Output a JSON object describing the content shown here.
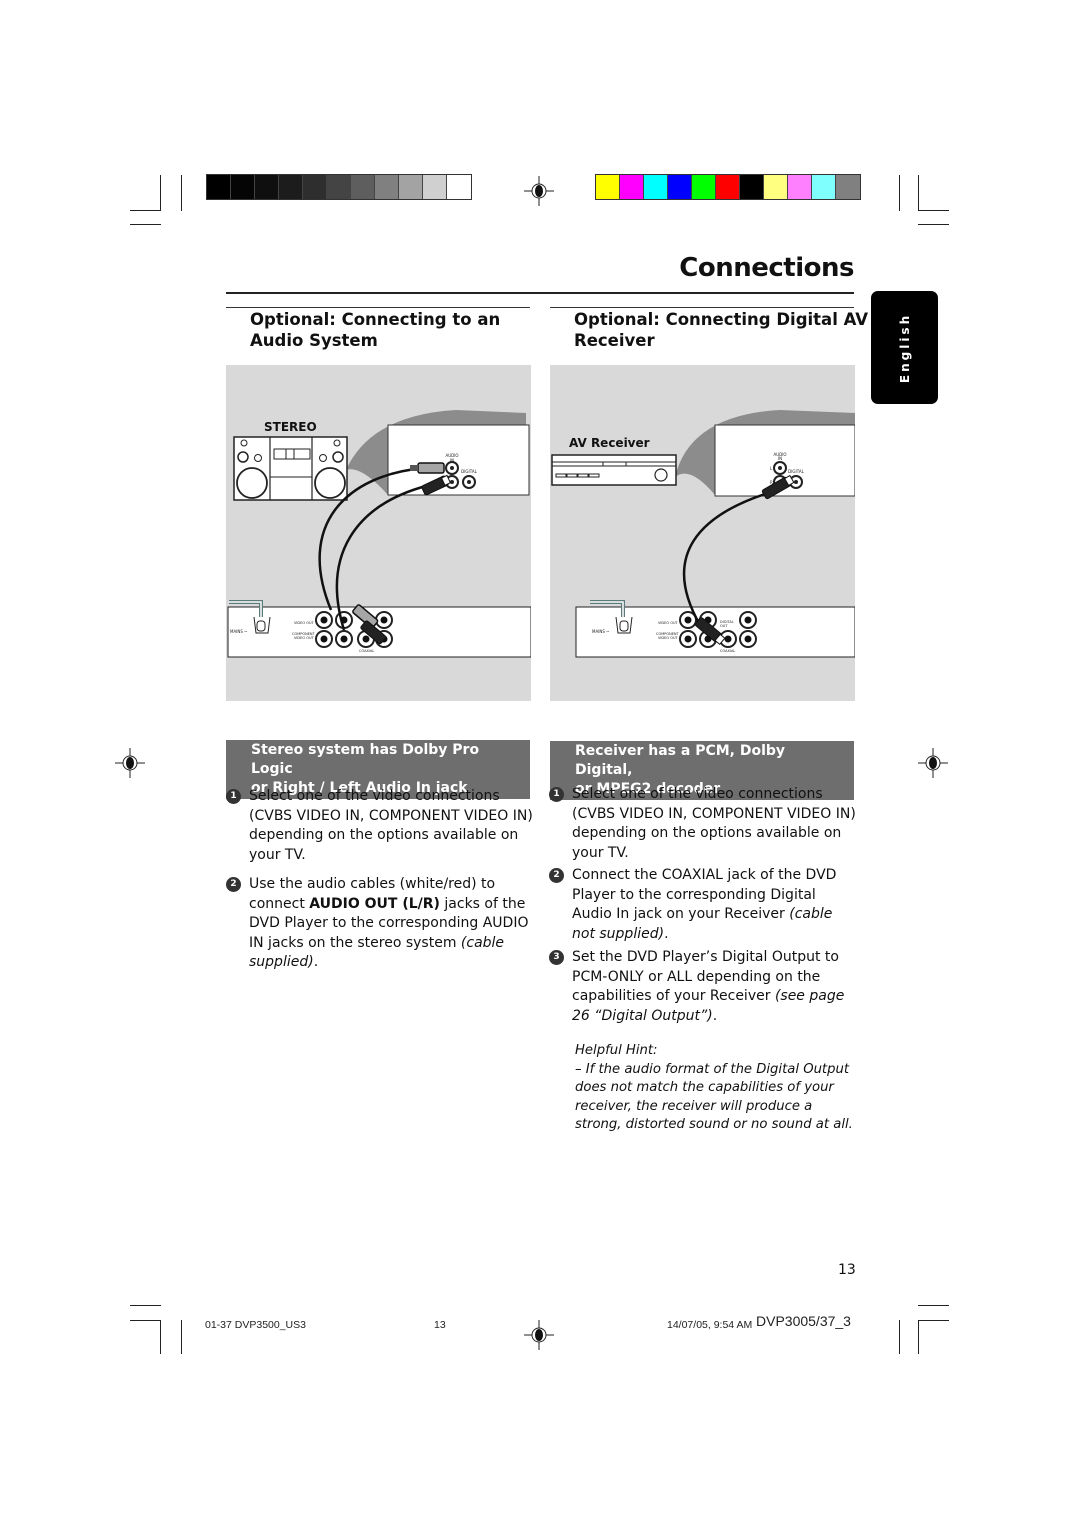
{
  "header": {
    "title": "Connections",
    "language_tab": "English"
  },
  "print_marks": {
    "grayscale_swatches": [
      "#000000",
      "#050505",
      "#0f0f0f",
      "#1c1c1c",
      "#2e2e2e",
      "#444444",
      "#5e5e5e",
      "#808080",
      "#a3a3a3",
      "#d0d0d0",
      "#ffffff"
    ],
    "color_swatches": [
      "#ffff00",
      "#ff00ff",
      "#00ffff",
      "#0000ff",
      "#00ff00",
      "#ff0000",
      "#000000",
      "#ffff80",
      "#ff80ff",
      "#80ffff",
      "#808080"
    ]
  },
  "left_section": {
    "heading_line1": "Optional: Connecting to an",
    "heading_line2": "Audio System",
    "figure": {
      "device_label": "STEREO",
      "jack_labels": {
        "audio_in": "AUDIO IN",
        "digital": "DIGITAL",
        "video_out": "VIDEO OUT",
        "component_video_out": "COMPONENT VIDEO OUT",
        "coaxial": "COAXIAL",
        "mains": "MAINS ~"
      }
    },
    "subheading_line1": "Stereo system has Dolby Pro Logic",
    "subheading_line2": "or Right / Left Audio In jack",
    "steps": [
      {
        "num": "1",
        "text": "Select one of the video connections (CVBS VIDEO IN, COMPONENT VIDEO IN) depending on the options available on your TV."
      },
      {
        "num": "2",
        "text_pre": "Use the audio cables (white/red) to connect ",
        "text_bold": "AUDIO OUT (L/R)",
        "text_mid": " jacks of the DVD Player to the corresponding AUDIO IN jacks on the stereo system ",
        "text_italic": "(cable supplied)",
        "text_post": "."
      }
    ]
  },
  "right_section": {
    "heading_line1": "Optional: Connecting Digital AV",
    "heading_line2": "Receiver",
    "figure": {
      "device_label": "AV Receiver",
      "jack_labels": {
        "audio_in": "AUDIO IN",
        "digital": "DIGITAL",
        "digital_out": "DIGITAL OUT",
        "video_out": "VIDEO OUT",
        "component_video_out": "COMPONENT VIDEO OUT",
        "coaxial": "COAXIAL",
        "mains": "MAINS ~"
      }
    },
    "subheading_line1": "Receiver has a PCM, Dolby Digital,",
    "subheading_line2": "or MPEG2 decoder",
    "steps": [
      {
        "num": "1",
        "text": "Select one of the video connections (CVBS VIDEO IN, COMPONENT VIDEO IN) depending on the options available on your TV."
      },
      {
        "num": "2",
        "text_pre": "Connect the COAXIAL jack of the DVD Player to the corresponding Digital Audio In jack on your Receiver ",
        "text_italic": "(cable not supplied)",
        "text_post": "."
      },
      {
        "num": "3",
        "text_pre": "Set the DVD Player’s Digital Output to PCM-ONLY or ALL depending on the capabilities of your Receiver ",
        "text_italic": "(see page 26 “Digital Output”)",
        "text_post": "."
      }
    ],
    "hint": {
      "title": "Helpful Hint:",
      "text": "–    If the audio format of the Digital Output does not match the capabilities of your receiver, the receiver will produce a strong, distorted sound or no sound at all."
    }
  },
  "page_number": "13",
  "footer": {
    "file": "01-37 DVP3500_US3",
    "page": "13",
    "timestamp": "14/07/05, 9:54 AM",
    "model": "DVP3005/37_3"
  }
}
